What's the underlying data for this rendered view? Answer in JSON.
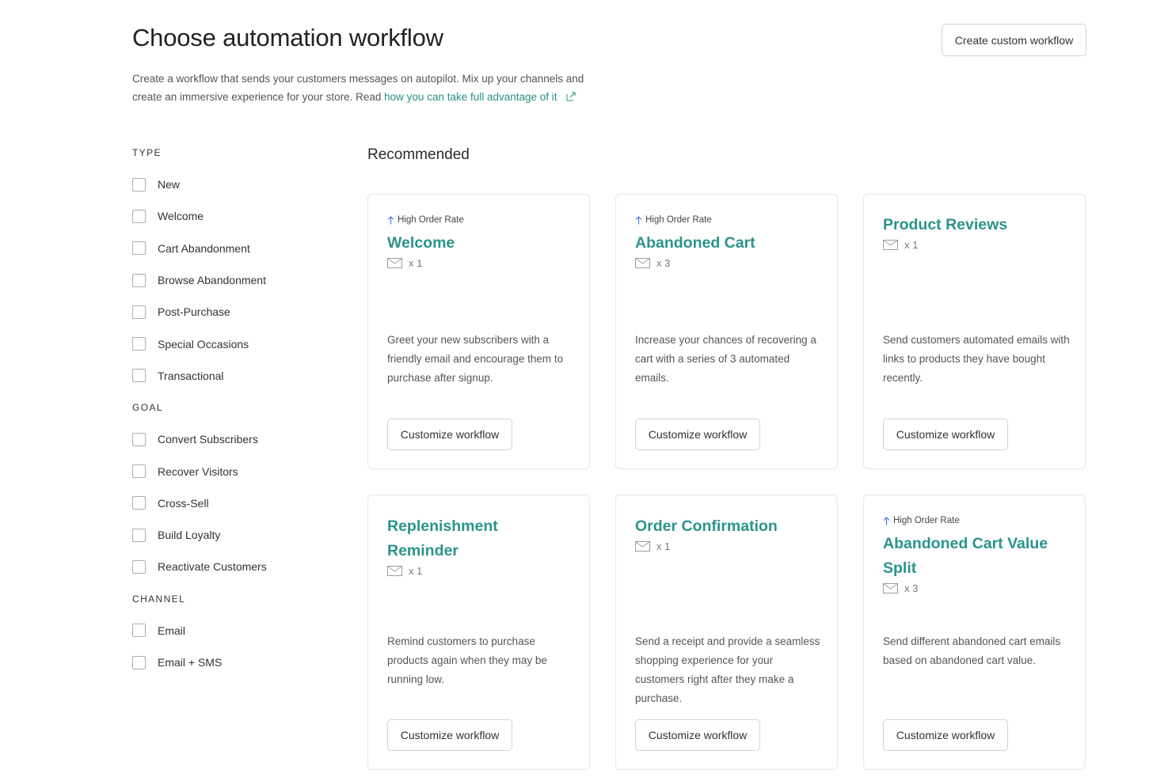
{
  "header": {
    "title": "Choose automation workflow",
    "create_button": "Create custom workflow",
    "intro_text": "Create a workflow that sends your customers messages on autopilot. Mix up your channels and create an immersive experience for your store. Read",
    "intro_link": "how you can take full advantage of it"
  },
  "filters": [
    {
      "heading": "TYPE",
      "items": [
        "New",
        "Welcome",
        "Cart Abandonment",
        "Browse Abandonment",
        "Post-Purchase",
        "Special Occasions",
        "Transactional"
      ]
    },
    {
      "heading": "GOAL",
      "items": [
        "Convert Subscribers",
        "Recover Visitors",
        "Cross-Sell",
        "Build Loyalty",
        "Reactivate Customers"
      ]
    },
    {
      "heading": "CHANNEL",
      "items": [
        "Email",
        "Email + SMS"
      ]
    }
  ],
  "section_title": "Recommended",
  "cards": [
    {
      "badge": "High Order Rate",
      "title": "Welcome",
      "count": "x 1",
      "description": "Greet your new subscribers with a friendly email and encourage them to purchase after signup.",
      "button": "Customize workflow"
    },
    {
      "badge": "High Order Rate",
      "title": "Abandoned Cart",
      "count": "x 3",
      "description": "Increase your chances of recovering a cart with a series of 3 automated emails.",
      "button": "Customize workflow"
    },
    {
      "badge": "",
      "title": "Product Reviews",
      "count": "x 1",
      "description": "Send customers automated emails with links to products they have bought recently.",
      "button": "Customize workflow"
    },
    {
      "badge": "",
      "title": "Replenishment Reminder",
      "count": "x 1",
      "description": "Remind customers to purchase products again when they may be running low.",
      "button": "Customize workflow"
    },
    {
      "badge": "",
      "title": "Order Confirmation",
      "count": "x 1",
      "description": "Send a receipt and provide a seamless shopping experience for your customers right after they make a purchase.",
      "button": "Customize workflow"
    },
    {
      "badge": "High Order Rate",
      "title": "Abandoned Cart Value Split",
      "count": "x 3",
      "description": "Send different abandoned cart emails based on abandoned cart value.",
      "button": "Customize workflow"
    }
  ],
  "colors": {
    "accent": "#2a948b",
    "link": "#2a8f87",
    "badge_arrow": "#3d7be0",
    "border": "#e3e6e9"
  }
}
